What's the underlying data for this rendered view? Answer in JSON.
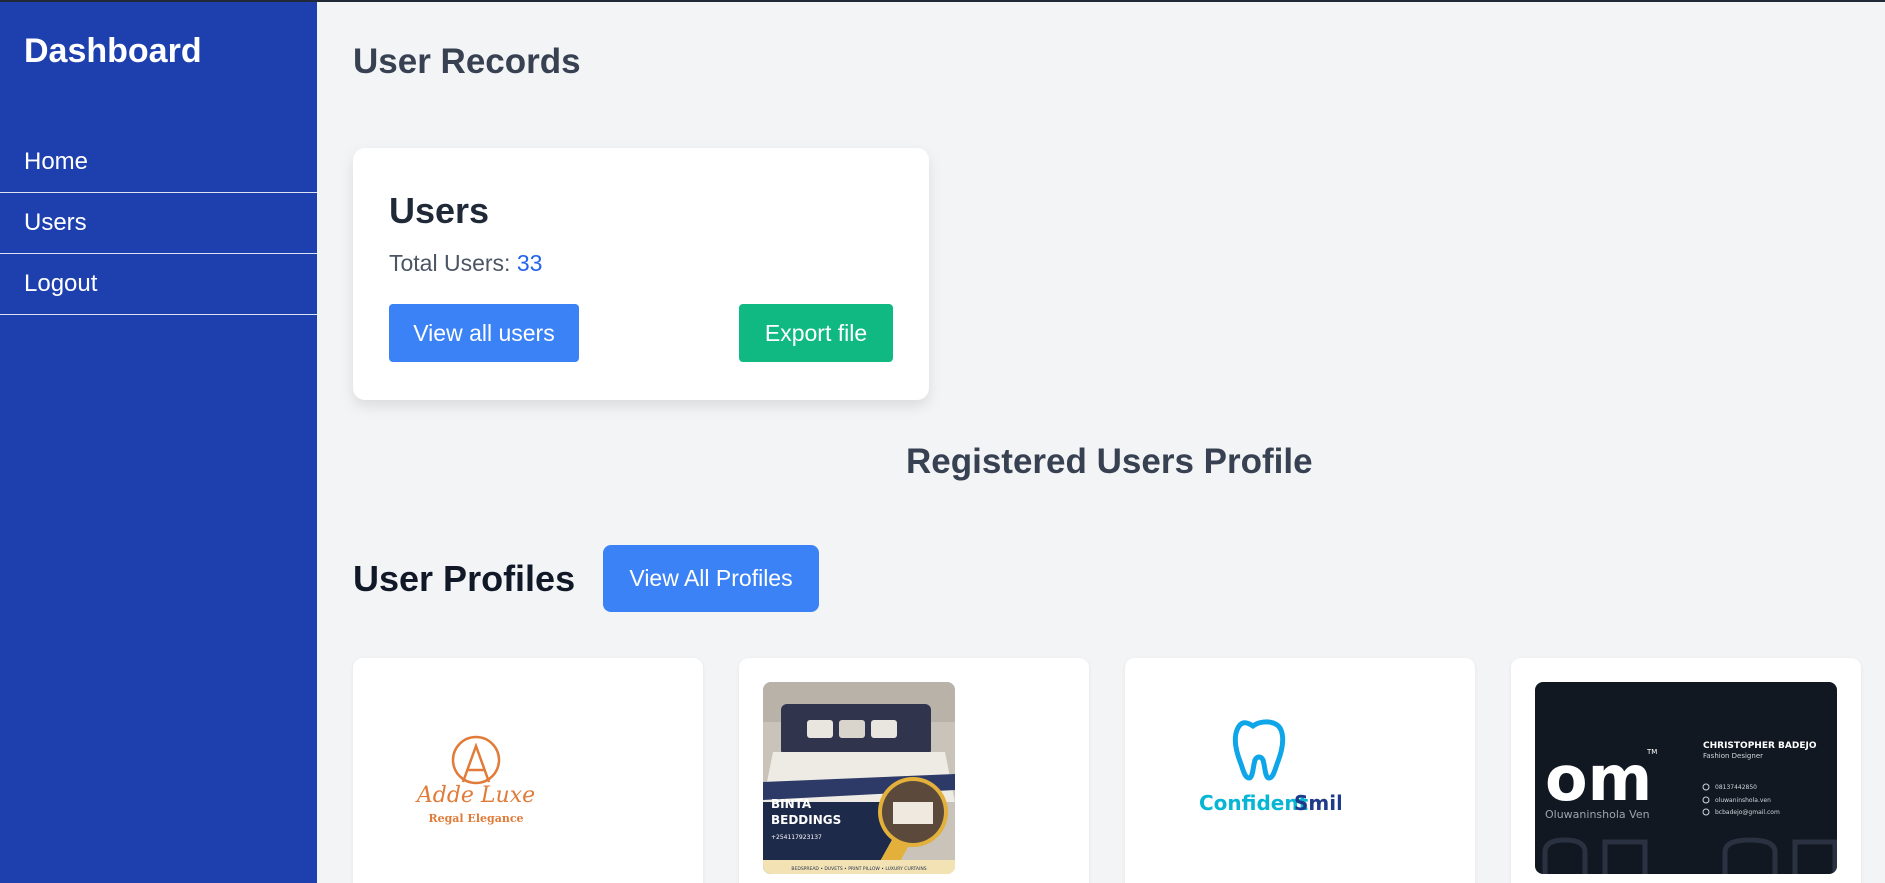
{
  "sidebar": {
    "brand": "Dashboard",
    "items": [
      {
        "label": "Home"
      },
      {
        "label": "Users"
      },
      {
        "label": "Logout"
      }
    ]
  },
  "main": {
    "title": "User Records",
    "users_card": {
      "title": "Users",
      "total_label": "Total Users:",
      "total_value": "33",
      "view_all_label": "View all users",
      "export_label": "Export file"
    },
    "section_title": "Registered Users Profile",
    "profiles": {
      "title": "User Profiles",
      "view_all_label": "View All Profiles",
      "cards": [
        {
          "logo_line1": "Adde Luxe",
          "logo_line2": "Regal Elegance"
        },
        {
          "logo_line1": "BINTA",
          "logo_line2": "BEDDINGS",
          "phone": "+254117923137",
          "tags": "BEDSPREAD • DUVETS • PRINT PILLOW • LUXURY CURTAINS"
        },
        {
          "logo_line1": "Confident",
          "logo_line2": "Smile"
        },
        {
          "mark": "om",
          "tm": "TM",
          "sub": "Oluwaninshola Ven",
          "name": "CHRISTOPHER BADEJO",
          "role": "Fashion Designer",
          "phone": "08137442850",
          "social": "oluwaninshola.ven",
          "email": "bcbadejo@gmail.com"
        }
      ]
    }
  },
  "colors": {
    "sidebar": "#1e40af",
    "primary_button": "#3b82f6",
    "export_button": "#10b981",
    "page_bg": "#f3f4f6"
  }
}
